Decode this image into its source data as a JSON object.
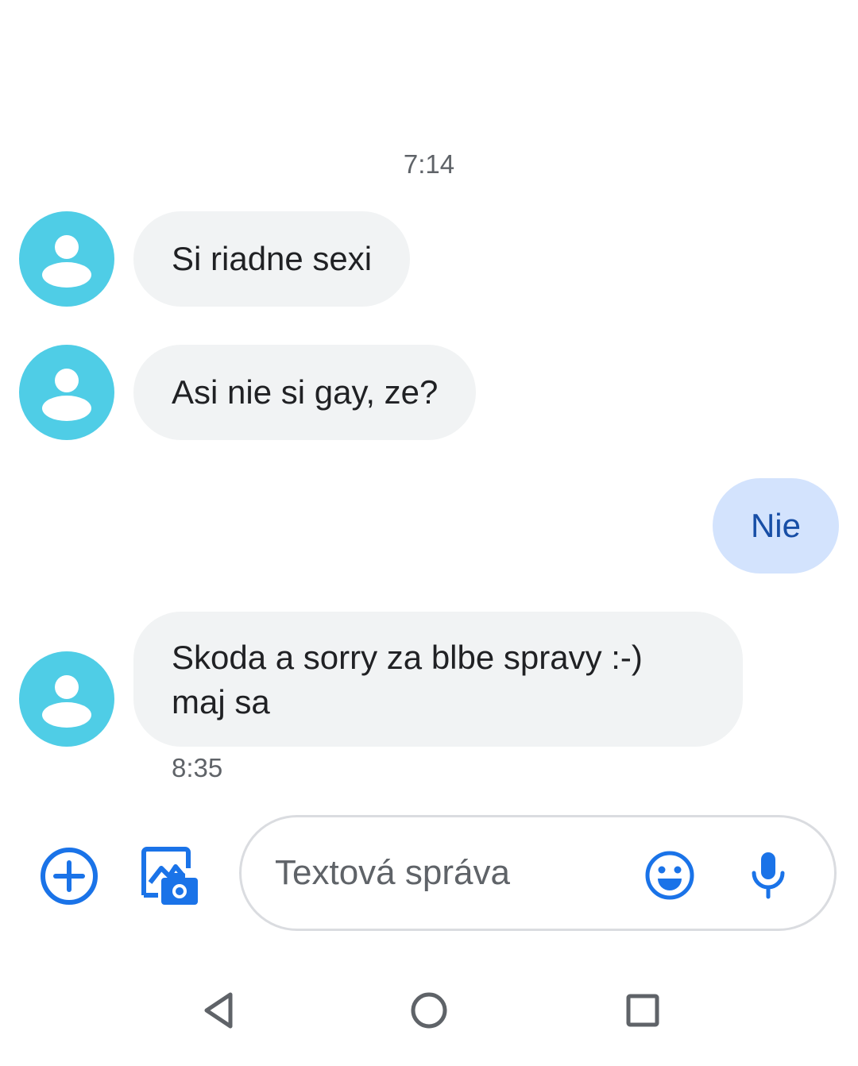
{
  "conversation": {
    "date_separator": "7:14",
    "messages": [
      {
        "direction": "incoming",
        "text": "Si riadne sexi"
      },
      {
        "direction": "incoming",
        "text": "Asi nie si gay, ze?"
      },
      {
        "direction": "outgoing",
        "text": "Nie"
      },
      {
        "direction": "incoming",
        "text": "Skoda a sorry za blbe spravy :-) maj sa"
      }
    ],
    "last_message_time": "8:35"
  },
  "compose": {
    "placeholder": "Textová správa",
    "add_icon": "add-circle-icon",
    "gallery_icon": "photo-camera-icon",
    "emoji_icon": "emoji-icon",
    "mic_icon": "microphone-icon"
  },
  "navigation": {
    "back_icon": "back-triangle-icon",
    "home_icon": "home-circle-icon",
    "recents_icon": "recents-square-icon"
  },
  "colors": {
    "accent": "#1a73e8",
    "avatar": "#4fcde6",
    "incoming_bubble": "#f1f3f4",
    "outgoing_bubble": "#d3e3fd",
    "outgoing_text": "#174ea6"
  }
}
